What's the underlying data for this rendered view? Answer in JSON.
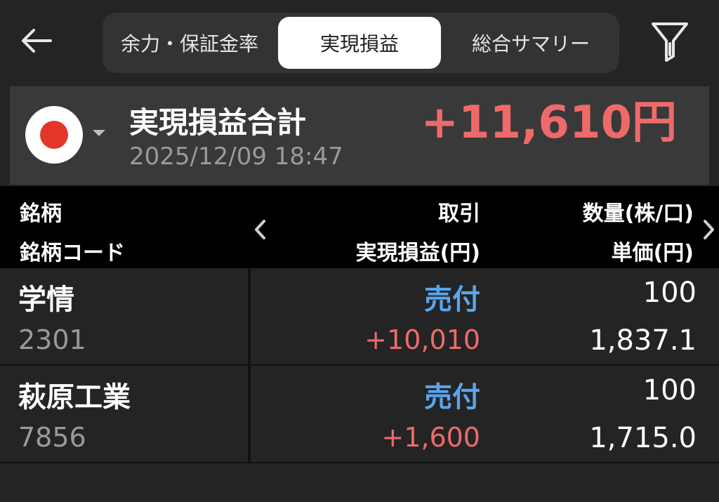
{
  "header": {
    "tabs": [
      {
        "label": "余力・保証金率",
        "active": false
      },
      {
        "label": "実現損益",
        "active": true
      },
      {
        "label": "総合サマリー",
        "active": false
      }
    ]
  },
  "summary": {
    "title": "実現損益合計",
    "datetime": "2025/12/09 18:47",
    "total": "+11,610円",
    "market_flag": "japan-flag-icon"
  },
  "table": {
    "col1_line1": "銘柄",
    "col1_line2": "銘柄コード",
    "col2_line1": "取引",
    "col2_line2": "実現損益(円)",
    "col3_line1": "数量(株/口)",
    "col3_line2": "単価(円)"
  },
  "rows": [
    {
      "name": "学情",
      "code": "2301",
      "trade": "売付",
      "pl": "+10,010",
      "qty": "100",
      "price": "1,837.1"
    },
    {
      "name": "萩原工業",
      "code": "7856",
      "trade": "売付",
      "pl": "+1,600",
      "qty": "100",
      "price": "1,715.0"
    }
  ],
  "colors": {
    "background": "#242424",
    "profit": "#ee6a6a",
    "trade": "#59a6ec",
    "header": "#000000",
    "card": "#393939"
  }
}
